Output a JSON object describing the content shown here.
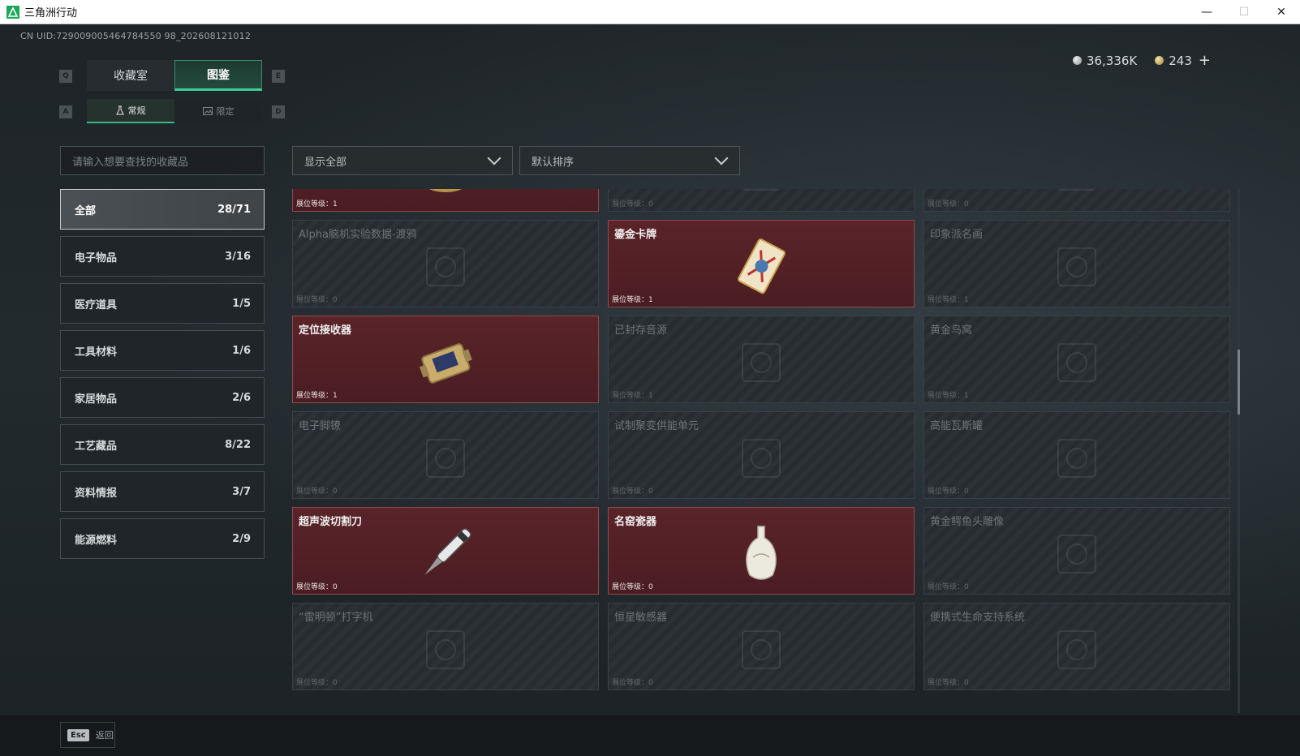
{
  "window": {
    "title": "三角洲行动"
  },
  "uid": "CN UID:729009005464784550 98_202608121012",
  "currency": {
    "silver": "36,336K",
    "gold": "243",
    "add": "+"
  },
  "keys": {
    "q": "Q",
    "e": "E",
    "a": "A",
    "d": "D"
  },
  "main_tabs": [
    {
      "label": "收藏室"
    },
    {
      "label": "图鉴"
    }
  ],
  "sub_tabs": [
    {
      "label": "常规"
    },
    {
      "label": "限定"
    }
  ],
  "search": {
    "placeholder": "请输入想要查找的收藏品"
  },
  "filters": {
    "show": "显示全部",
    "sort": "默认排序"
  },
  "categories": [
    {
      "label": "全部",
      "count": "28/71"
    },
    {
      "label": "电子物品",
      "count": "3/16"
    },
    {
      "label": "医疗道具",
      "count": "1/5"
    },
    {
      "label": "工具材料",
      "count": "1/6"
    },
    {
      "label": "家居物品",
      "count": "2/6"
    },
    {
      "label": "工艺藏品",
      "count": "8/22"
    },
    {
      "label": "资料情报",
      "count": "3/7"
    },
    {
      "label": "能源燃料",
      "count": "2/9"
    }
  ],
  "items": [
    {
      "name": "",
      "level": "展位等级：1",
      "owned": true,
      "icon": "caviar-tin-icon"
    },
    {
      "name": "",
      "level": "展位等级：0",
      "owned": false,
      "icon": "item-silhouette-icon"
    },
    {
      "name": "",
      "level": "展位等级：0",
      "owned": false,
      "icon": "item-silhouette-icon"
    },
    {
      "name": "Alpha脑机实验数据-渡鸦",
      "level": "展位等级：0",
      "owned": false,
      "icon": "data-drive-icon"
    },
    {
      "name": "鎏金卡牌",
      "level": "展位等级：1",
      "owned": true,
      "icon": "gilded-card-icon"
    },
    {
      "name": "印象派名画",
      "level": "展位等级：1",
      "owned": false,
      "icon": "painting-icon"
    },
    {
      "name": "定位接收器",
      "level": "展位等级：1",
      "owned": true,
      "icon": "gps-receiver-icon"
    },
    {
      "name": "已封存音源",
      "level": "展位等级：1",
      "owned": false,
      "icon": "audio-source-icon"
    },
    {
      "name": "黄金鸟窝",
      "level": "展位等级：1",
      "owned": false,
      "icon": "golden-nest-icon"
    },
    {
      "name": "电子脚镣",
      "level": "展位等级：0",
      "owned": false,
      "icon": "ankle-monitor-icon"
    },
    {
      "name": "试制聚变供能单元",
      "level": "展位等级：0",
      "owned": false,
      "icon": "fusion-cell-icon"
    },
    {
      "name": "高能瓦斯罐",
      "level": "展位等级：0",
      "owned": false,
      "icon": "gas-canister-icon"
    },
    {
      "name": "超声波切割刀",
      "level": "展位等级：0",
      "owned": true,
      "icon": "ultrasonic-knife-icon"
    },
    {
      "name": "名窑瓷器",
      "level": "展位等级：0",
      "owned": true,
      "icon": "porcelain-vase-icon"
    },
    {
      "name": "黄金鳄鱼头雕像",
      "level": "展位等级：0",
      "owned": false,
      "icon": "crocodile-statue-icon"
    },
    {
      "name": "“雷明顿”打字机",
      "level": "展位等级：0",
      "owned": false,
      "icon": "typewriter-icon"
    },
    {
      "name": "恒星敏感器",
      "level": "展位等级：0",
      "owned": false,
      "icon": "star-sensor-icon"
    },
    {
      "name": "便携式生命支持系统",
      "level": "展位等级：0",
      "owned": false,
      "icon": "life-support-icon"
    }
  ],
  "footer": {
    "esc_key": "Esc",
    "back_label": "返回"
  }
}
